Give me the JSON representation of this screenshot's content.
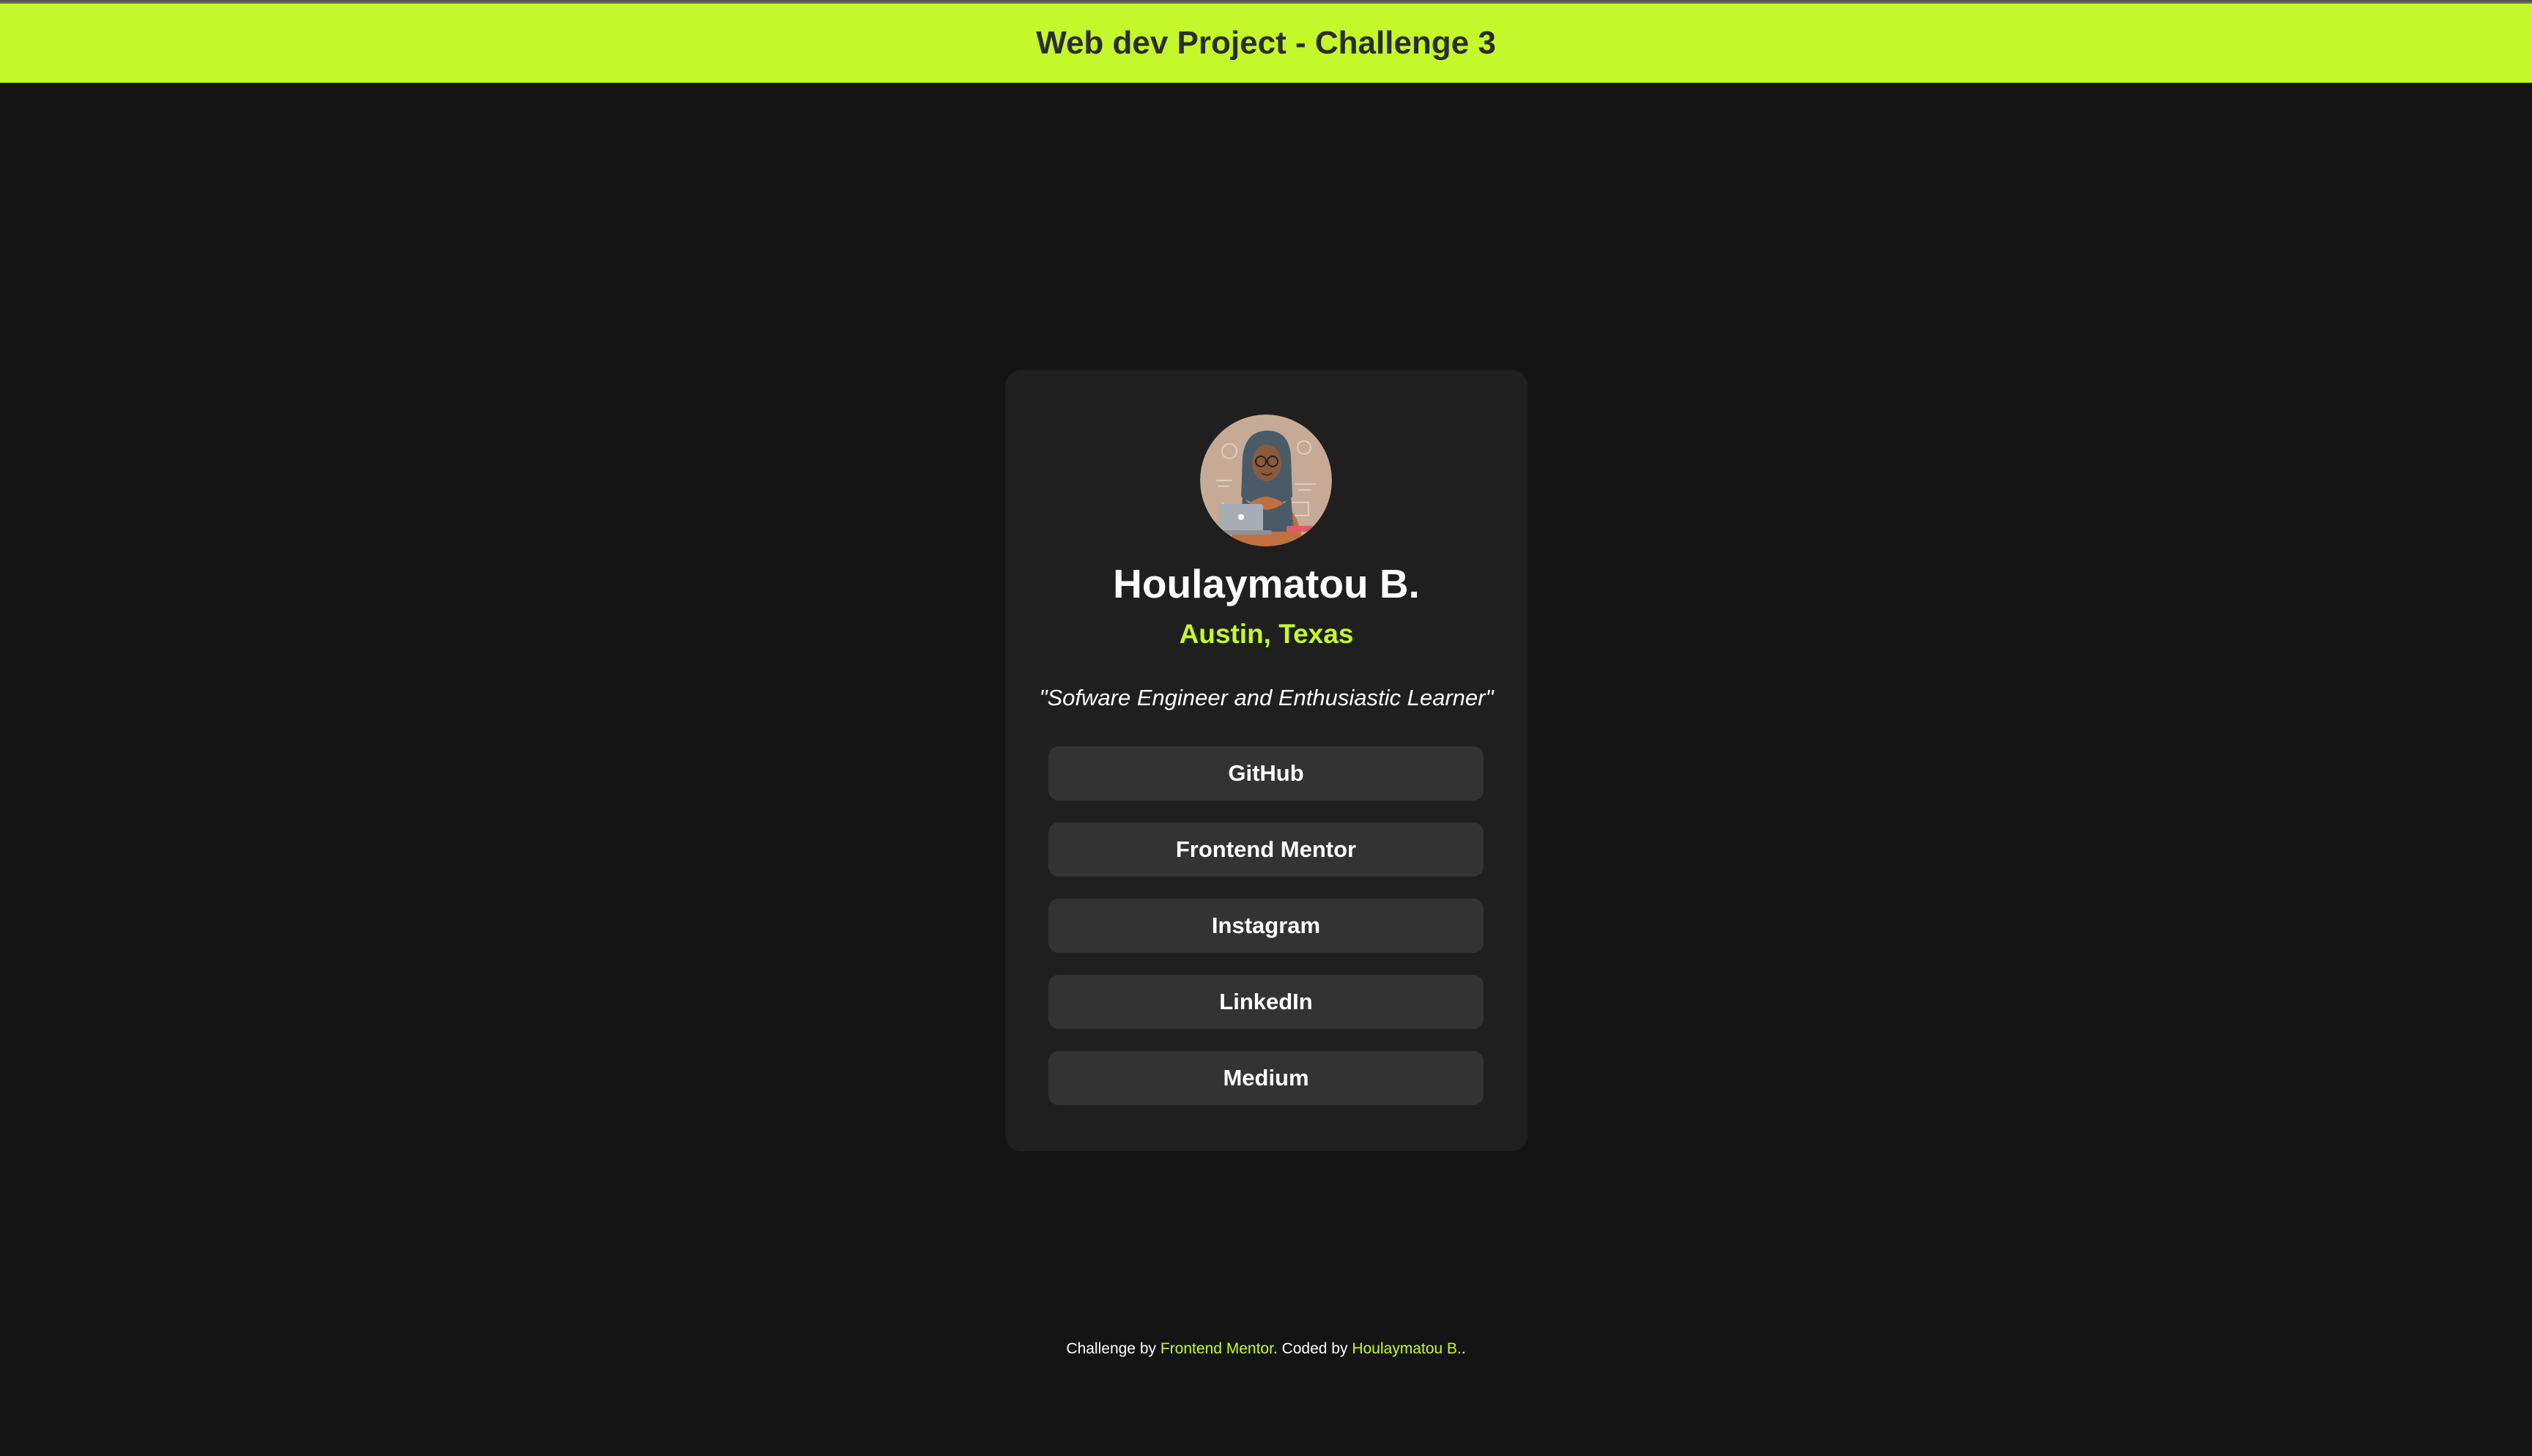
{
  "header": {
    "title": "Web dev Project - Challenge 3"
  },
  "profile": {
    "avatar_icon": "avatar-illustration",
    "name": "Houlaymatou B.",
    "location": "Austin, Texas",
    "bio": "\"Sofware Engineer and Enthusiastic Learner\""
  },
  "links": [
    {
      "label": "GitHub"
    },
    {
      "label": "Frontend Mentor"
    },
    {
      "label": "Instagram"
    },
    {
      "label": "LinkedIn"
    },
    {
      "label": "Medium"
    }
  ],
  "footer": {
    "prefix": "Challenge by ",
    "challenge_link": "Frontend Mentor",
    "middle": ". Coded by ",
    "author_link": "Houlaymatou B.",
    "suffix": "."
  },
  "colors": {
    "accent": "#c4f82a",
    "background": "#141414",
    "card": "#1f1f1f",
    "button": "#333333"
  }
}
